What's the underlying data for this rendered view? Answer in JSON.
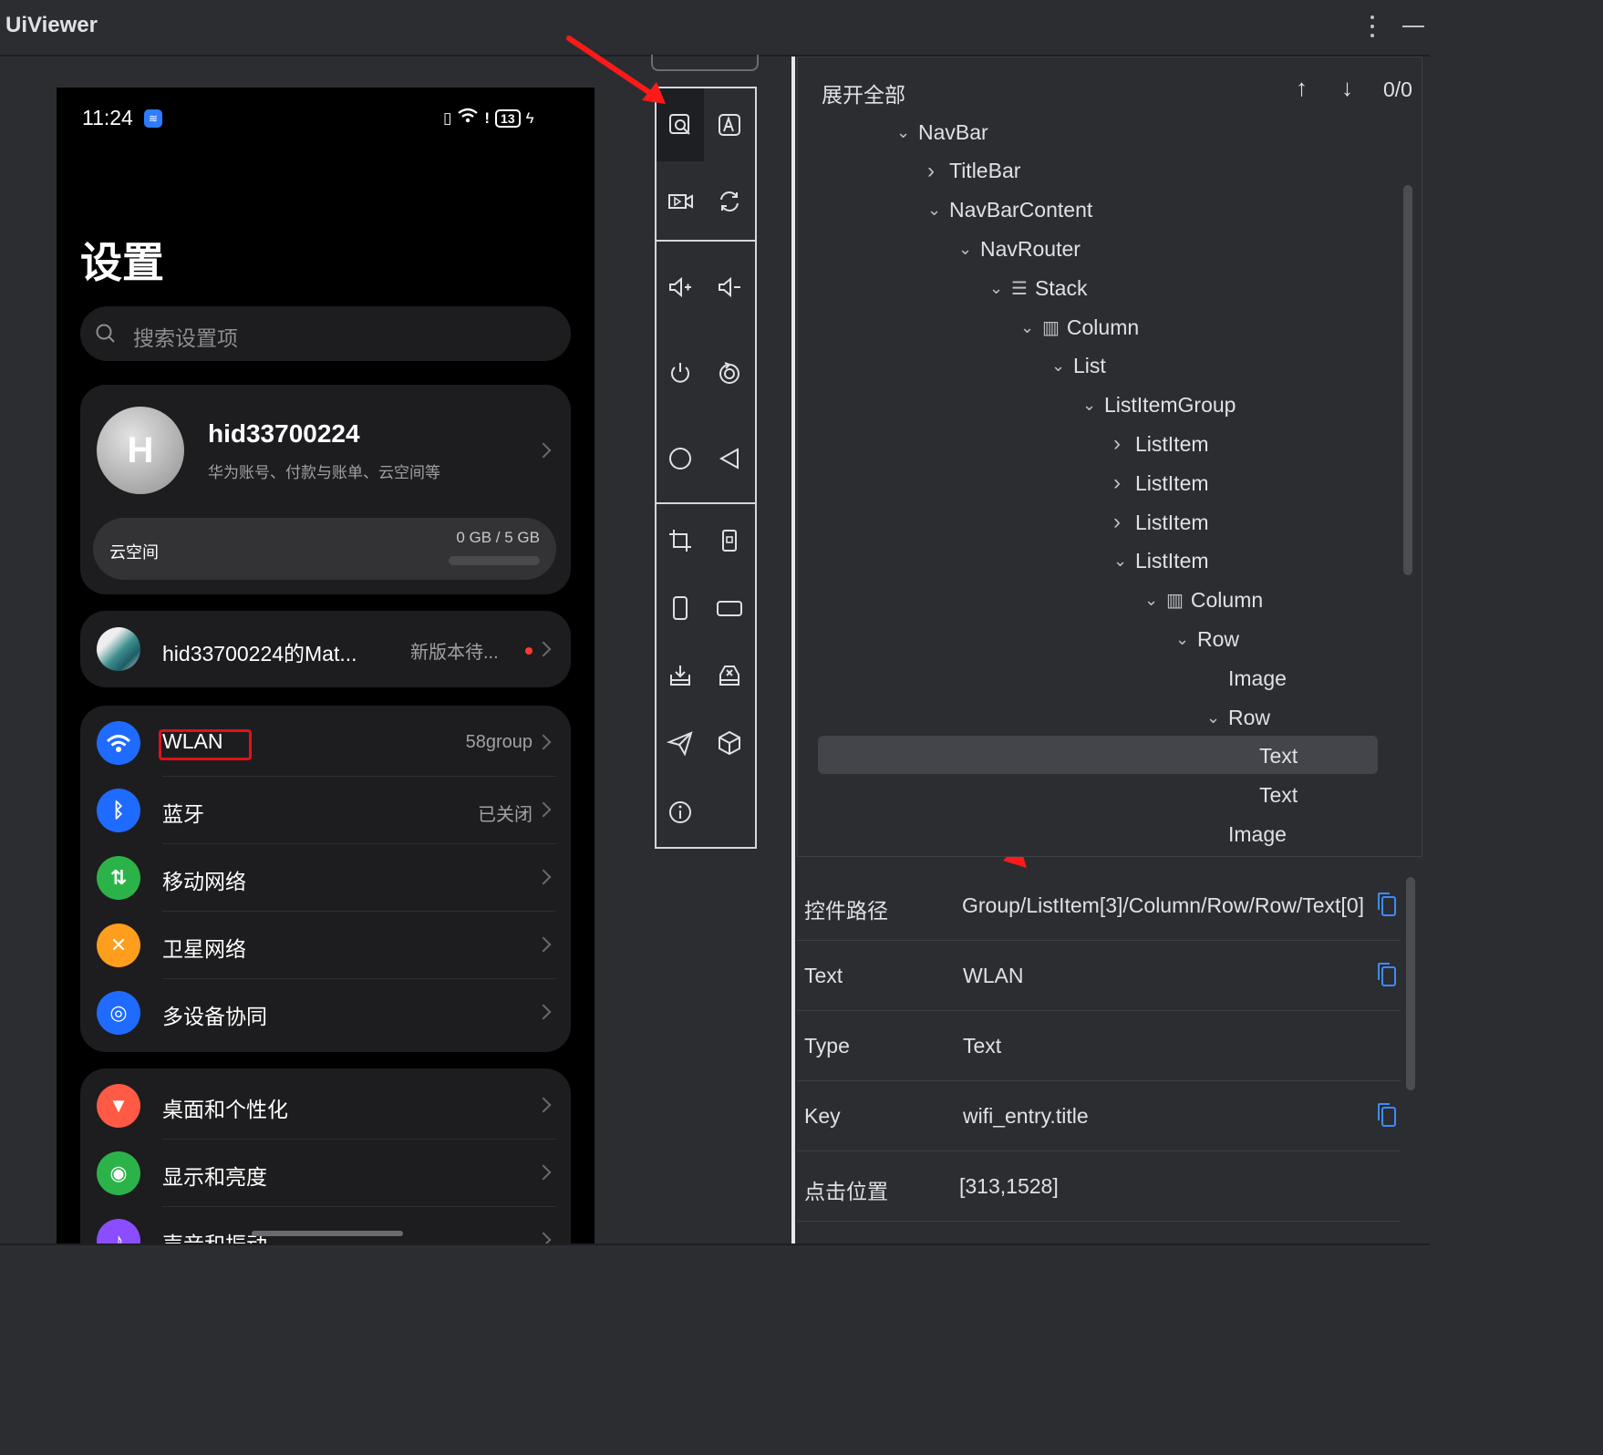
{
  "window": {
    "title": "UiViewer"
  },
  "colors": {
    "accent": "#2f7bff",
    "highlight": "#e0111b",
    "selected_row": "#43454a",
    "copy_icon": "#3d8bff"
  },
  "toolbar_icons": [
    "inspect-icon",
    "font-check-icon",
    "record-video-icon",
    "refresh-icon",
    "volume-up-icon",
    "volume-down-icon",
    "power-icon",
    "reboot-icon",
    "home-icon",
    "back-icon",
    "crop-icon",
    "rotate-screen-icon",
    "portrait-icon",
    "landscape-icon",
    "install-app-icon",
    "uninstall-app-icon",
    "send-icon",
    "package-icon",
    "info-icon"
  ],
  "phone": {
    "time": "11:24",
    "battery": "13",
    "title": "设置",
    "search_placeholder": "搜索设置项",
    "account": {
      "avatar_letter": "H",
      "name": "hid33700224",
      "subtitle": "华为账号、付款与账单、云空间等"
    },
    "cloud": {
      "label": "云空间",
      "usage": "0 GB / 5 GB"
    },
    "device": {
      "name": "hid33700224的Mat...",
      "status": "新版本待..."
    },
    "connectivity": [
      {
        "label": "WLAN",
        "value": "58group",
        "icon": "wifi-icon",
        "color": "#1f6bff"
      },
      {
        "label": "蓝牙",
        "value": "已关闭",
        "icon": "bluetooth-icon",
        "color": "#1f6bff"
      },
      {
        "label": "移动网络",
        "value": "",
        "icon": "mobile-data-icon",
        "color": "#2bb34a"
      },
      {
        "label": "卫星网络",
        "value": "",
        "icon": "satellite-icon",
        "color": "#ff9d1c"
      },
      {
        "label": "多设备协同",
        "value": "",
        "icon": "multi-device-icon",
        "color": "#1f6bff"
      }
    ],
    "personalization": [
      {
        "label": "桌面和个性化",
        "icon": "paintbrush-icon",
        "color": "#ff5a45"
      },
      {
        "label": "显示和亮度",
        "icon": "eye-icon",
        "color": "#2bb34a"
      },
      {
        "label": "声音和振动",
        "icon": "sound-icon",
        "color": "#8a4dff"
      }
    ]
  },
  "tree": {
    "expand_all": "展开全部",
    "search_count": "0/0",
    "nodes": [
      {
        "label": "NavBar",
        "depth": 0,
        "toggle": "expanded",
        "icon": ""
      },
      {
        "label": "TitleBar",
        "depth": 1,
        "toggle": "collapsed",
        "icon": ""
      },
      {
        "label": "NavBarContent",
        "depth": 1,
        "toggle": "expanded",
        "icon": ""
      },
      {
        "label": "NavRouter",
        "depth": 2,
        "toggle": "expanded",
        "icon": ""
      },
      {
        "label": "Stack",
        "depth": 3,
        "toggle": "expanded",
        "icon": "stack-icon"
      },
      {
        "label": "Column",
        "depth": 4,
        "toggle": "expanded",
        "icon": "column-icon"
      },
      {
        "label": "List",
        "depth": 5,
        "toggle": "expanded",
        "icon": ""
      },
      {
        "label": "ListItemGroup",
        "depth": 6,
        "toggle": "expanded",
        "icon": ""
      },
      {
        "label": "ListItem",
        "depth": 7,
        "toggle": "collapsed",
        "icon": ""
      },
      {
        "label": "ListItem",
        "depth": 7,
        "toggle": "collapsed",
        "icon": ""
      },
      {
        "label": "ListItem",
        "depth": 7,
        "toggle": "collapsed",
        "icon": ""
      },
      {
        "label": "ListItem",
        "depth": 7,
        "toggle": "expanded",
        "icon": ""
      },
      {
        "label": "Column",
        "depth": 8,
        "toggle": "expanded",
        "icon": "column-icon"
      },
      {
        "label": "Row",
        "depth": 9,
        "toggle": "expanded",
        "icon": ""
      },
      {
        "label": "Image",
        "depth": 10,
        "toggle": "none",
        "icon": ""
      },
      {
        "label": "Row",
        "depth": 10,
        "toggle": "expanded",
        "icon": ""
      },
      {
        "label": "Text",
        "depth": 11,
        "toggle": "none",
        "icon": "",
        "selected": true
      },
      {
        "label": "Text",
        "depth": 11,
        "toggle": "none",
        "icon": ""
      },
      {
        "label": "Image",
        "depth": 10,
        "toggle": "none",
        "icon": ""
      }
    ]
  },
  "properties": [
    {
      "key": "控件路径",
      "value": "Group/ListItem[3]/Column/Row/Row/Text[0]",
      "copy": true
    },
    {
      "key": "Text",
      "value": "WLAN",
      "copy": true
    },
    {
      "key": "Type",
      "value": "Text",
      "copy": false
    },
    {
      "key": "Key",
      "value": "wifi_entry.title",
      "copy": true
    },
    {
      "key": "点击位置",
      "value": "[313,1528]",
      "copy": false
    }
  ]
}
